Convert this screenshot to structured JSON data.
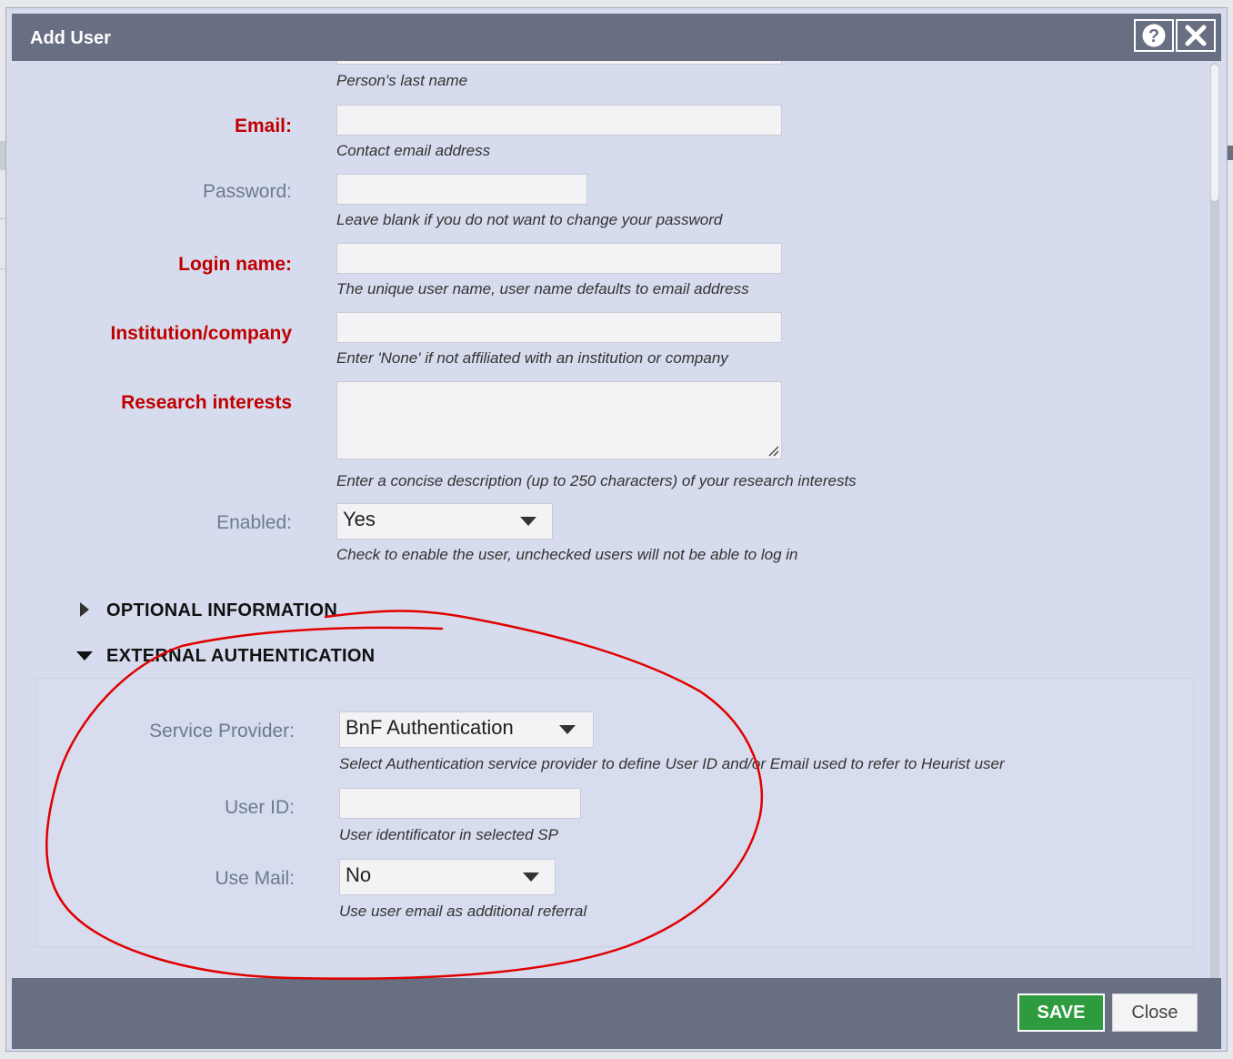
{
  "dialog": {
    "title": "Add User",
    "help_icon": "question-icon",
    "close_icon": "close-icon"
  },
  "form": {
    "last_name": {
      "hint": "Person's last name"
    },
    "email": {
      "label": "Email:",
      "value": "",
      "hint": "Contact email address"
    },
    "password": {
      "label": "Password:",
      "value": "",
      "hint": "Leave blank if you do not want to change your password"
    },
    "login_name": {
      "label": "Login name:",
      "value": "",
      "hint": "The unique user name, user name defaults to email address"
    },
    "institution": {
      "label": "Institution/company",
      "value": "",
      "hint": "Enter 'None' if not affiliated with an institution or company"
    },
    "research": {
      "label": "Research interests",
      "value": "",
      "hint": "Enter a concise description (up to 250 characters) of your research interests"
    },
    "enabled": {
      "label": "Enabled:",
      "value": "Yes",
      "hint": "Check to enable the user, unchecked users will not be able to log in"
    }
  },
  "sections": {
    "optional": "OPTIONAL INFORMATION",
    "external": "EXTERNAL AUTHENTICATION"
  },
  "external": {
    "provider": {
      "label": "Service Provider:",
      "value": "BnF Authentication",
      "hint": "Select Authentication service provider to define User ID and/or Email used to refer to Heurist user"
    },
    "user_id": {
      "label": "User ID:",
      "value": "",
      "hint": "User identificator in selected SP"
    },
    "use_mail": {
      "label": "Use Mail:",
      "value": "No",
      "hint": "Use user email as additional referral"
    }
  },
  "footer": {
    "save": "SAVE",
    "close": "Close"
  },
  "colors": {
    "required_label": "#c00000",
    "optional_label": "#6b7a95",
    "title_bar": "#696f82",
    "save_button": "#2f9b3f",
    "annotation": "#e00000"
  }
}
